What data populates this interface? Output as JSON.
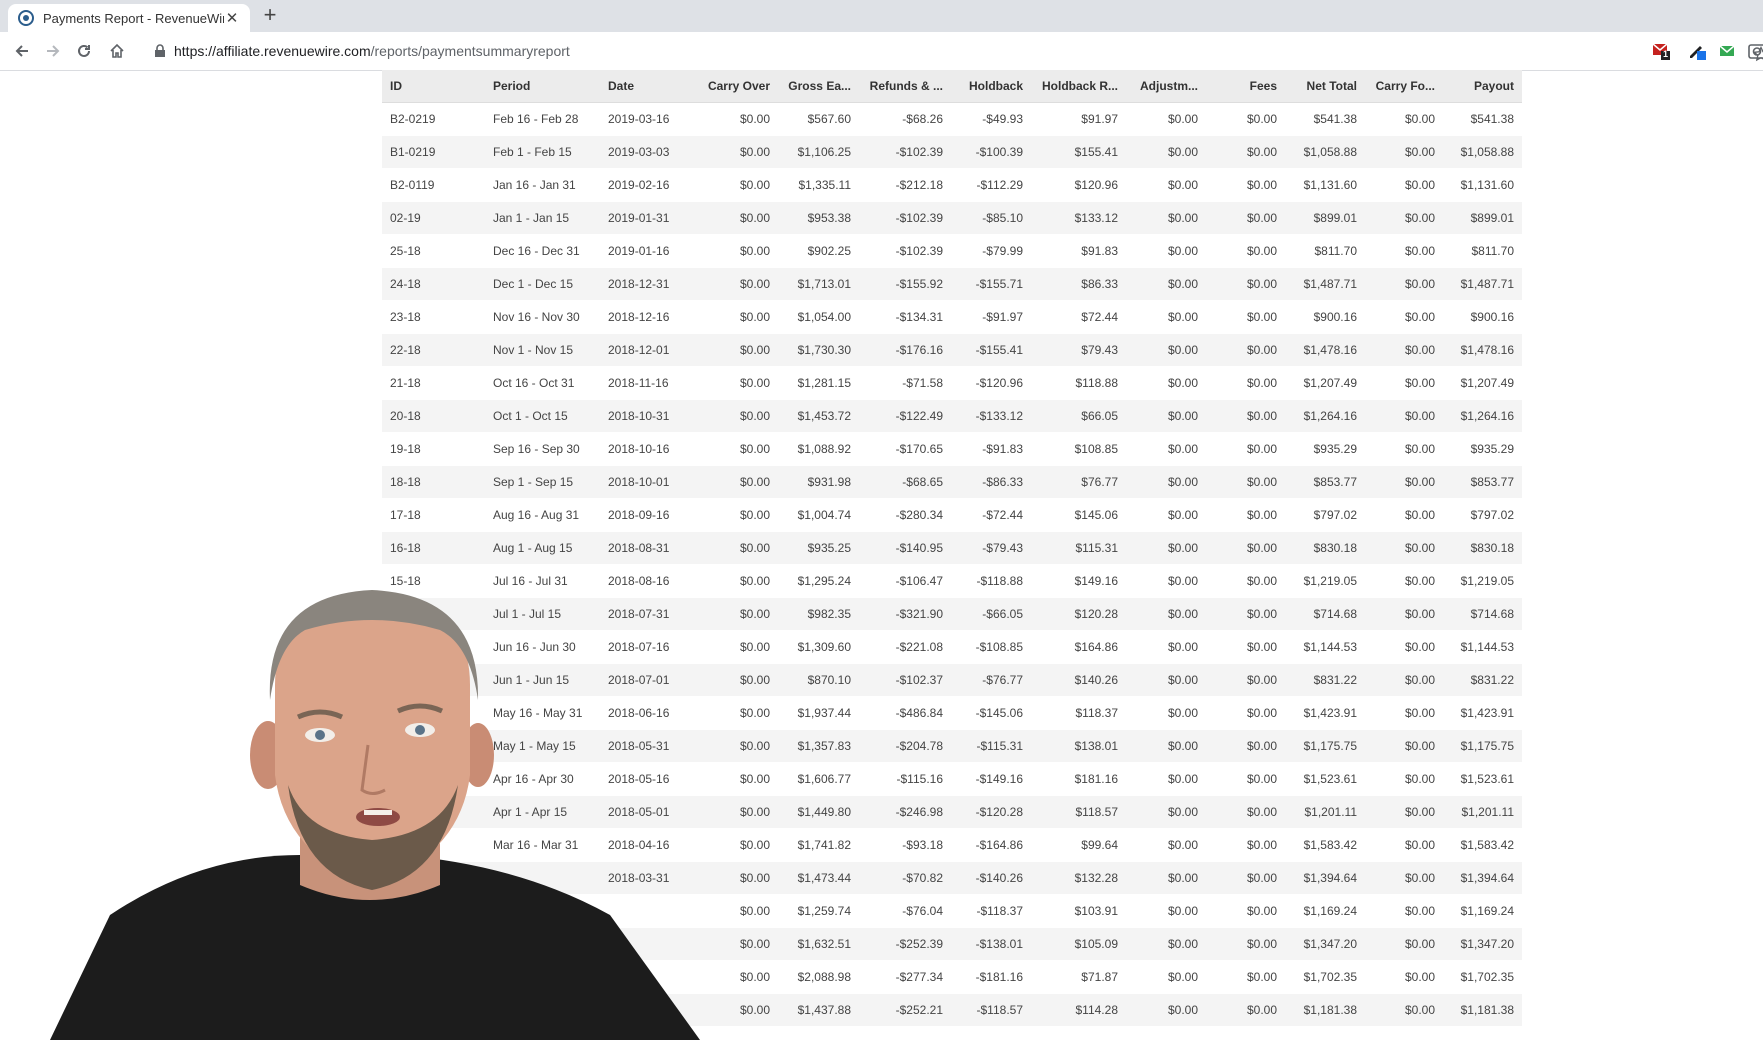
{
  "browser": {
    "tab_title": "Payments Report - RevenueWire",
    "url_host": "https://affiliate.revenuewire.com",
    "url_path": "/reports/paymentsummaryreport",
    "ext_badge": "1"
  },
  "table": {
    "columns": [
      "ID",
      "Period",
      "Date",
      "Carry Over",
      "Gross Ea...",
      "Refunds & ...",
      "Holdback",
      "Holdback R...",
      "Adjustm...",
      "Fees",
      "Net Total",
      "Carry Fo...",
      "Payout"
    ],
    "rows": [
      [
        "B2-0219",
        "Feb 16 - Feb 28",
        "2019-03-16",
        "$0.00",
        "$567.60",
        "-$68.26",
        "-$49.93",
        "$91.97",
        "$0.00",
        "$0.00",
        "$541.38",
        "$0.00",
        "$541.38"
      ],
      [
        "B1-0219",
        "Feb 1 - Feb 15",
        "2019-03-03",
        "$0.00",
        "$1,106.25",
        "-$102.39",
        "-$100.39",
        "$155.41",
        "$0.00",
        "$0.00",
        "$1,058.88",
        "$0.00",
        "$1,058.88"
      ],
      [
        "B2-0119",
        "Jan 16 - Jan 31",
        "2019-02-16",
        "$0.00",
        "$1,335.11",
        "-$212.18",
        "-$112.29",
        "$120.96",
        "$0.00",
        "$0.00",
        "$1,131.60",
        "$0.00",
        "$1,131.60"
      ],
      [
        "02-19",
        "Jan 1 - Jan 15",
        "2019-01-31",
        "$0.00",
        "$953.38",
        "-$102.39",
        "-$85.10",
        "$133.12",
        "$0.00",
        "$0.00",
        "$899.01",
        "$0.00",
        "$899.01"
      ],
      [
        "25-18",
        "Dec 16 - Dec 31",
        "2019-01-16",
        "$0.00",
        "$902.25",
        "-$102.39",
        "-$79.99",
        "$91.83",
        "$0.00",
        "$0.00",
        "$811.70",
        "$0.00",
        "$811.70"
      ],
      [
        "24-18",
        "Dec 1 - Dec 15",
        "2018-12-31",
        "$0.00",
        "$1,713.01",
        "-$155.92",
        "-$155.71",
        "$86.33",
        "$0.00",
        "$0.00",
        "$1,487.71",
        "$0.00",
        "$1,487.71"
      ],
      [
        "23-18",
        "Nov 16 - Nov 30",
        "2018-12-16",
        "$0.00",
        "$1,054.00",
        "-$134.31",
        "-$91.97",
        "$72.44",
        "$0.00",
        "$0.00",
        "$900.16",
        "$0.00",
        "$900.16"
      ],
      [
        "22-18",
        "Nov 1 - Nov 15",
        "2018-12-01",
        "$0.00",
        "$1,730.30",
        "-$176.16",
        "-$155.41",
        "$79.43",
        "$0.00",
        "$0.00",
        "$1,478.16",
        "$0.00",
        "$1,478.16"
      ],
      [
        "21-18",
        "Oct 16 - Oct 31",
        "2018-11-16",
        "$0.00",
        "$1,281.15",
        "-$71.58",
        "-$120.96",
        "$118.88",
        "$0.00",
        "$0.00",
        "$1,207.49",
        "$0.00",
        "$1,207.49"
      ],
      [
        "20-18",
        "Oct 1 - Oct 15",
        "2018-10-31",
        "$0.00",
        "$1,453.72",
        "-$122.49",
        "-$133.12",
        "$66.05",
        "$0.00",
        "$0.00",
        "$1,264.16",
        "$0.00",
        "$1,264.16"
      ],
      [
        "19-18",
        "Sep 16 - Sep 30",
        "2018-10-16",
        "$0.00",
        "$1,088.92",
        "-$170.65",
        "-$91.83",
        "$108.85",
        "$0.00",
        "$0.00",
        "$935.29",
        "$0.00",
        "$935.29"
      ],
      [
        "18-18",
        "Sep 1 - Sep 15",
        "2018-10-01",
        "$0.00",
        "$931.98",
        "-$68.65",
        "-$86.33",
        "$76.77",
        "$0.00",
        "$0.00",
        "$853.77",
        "$0.00",
        "$853.77"
      ],
      [
        "17-18",
        "Aug 16 - Aug 31",
        "2018-09-16",
        "$0.00",
        "$1,004.74",
        "-$280.34",
        "-$72.44",
        "$145.06",
        "$0.00",
        "$0.00",
        "$797.02",
        "$0.00",
        "$797.02"
      ],
      [
        "16-18",
        "Aug 1 - Aug 15",
        "2018-08-31",
        "$0.00",
        "$935.25",
        "-$140.95",
        "-$79.43",
        "$115.31",
        "$0.00",
        "$0.00",
        "$830.18",
        "$0.00",
        "$830.18"
      ],
      [
        "15-18",
        "Jul 16 - Jul 31",
        "2018-08-16",
        "$0.00",
        "$1,295.24",
        "-$106.47",
        "-$118.88",
        "$149.16",
        "$0.00",
        "$0.00",
        "$1,219.05",
        "$0.00",
        "$1,219.05"
      ],
      [
        "",
        "Jul 1 - Jul 15",
        "2018-07-31",
        "$0.00",
        "$982.35",
        "-$321.90",
        "-$66.05",
        "$120.28",
        "$0.00",
        "$0.00",
        "$714.68",
        "$0.00",
        "$714.68"
      ],
      [
        "",
        "Jun 16 - Jun 30",
        "2018-07-16",
        "$0.00",
        "$1,309.60",
        "-$221.08",
        "-$108.85",
        "$164.86",
        "$0.00",
        "$0.00",
        "$1,144.53",
        "$0.00",
        "$1,144.53"
      ],
      [
        "",
        "Jun 1 - Jun 15",
        "2018-07-01",
        "$0.00",
        "$870.10",
        "-$102.37",
        "-$76.77",
        "$140.26",
        "$0.00",
        "$0.00",
        "$831.22",
        "$0.00",
        "$831.22"
      ],
      [
        "",
        "May 16 - May 31",
        "2018-06-16",
        "$0.00",
        "$1,937.44",
        "-$486.84",
        "-$145.06",
        "$118.37",
        "$0.00",
        "$0.00",
        "$1,423.91",
        "$0.00",
        "$1,423.91"
      ],
      [
        "",
        "May 1 - May 15",
        "2018-05-31",
        "$0.00",
        "$1,357.83",
        "-$204.78",
        "-$115.31",
        "$138.01",
        "$0.00",
        "$0.00",
        "$1,175.75",
        "$0.00",
        "$1,175.75"
      ],
      [
        "",
        "Apr 16 - Apr 30",
        "2018-05-16",
        "$0.00",
        "$1,606.77",
        "-$115.16",
        "-$149.16",
        "$181.16",
        "$0.00",
        "$0.00",
        "$1,523.61",
        "$0.00",
        "$1,523.61"
      ],
      [
        "",
        "Apr 1 - Apr 15",
        "2018-05-01",
        "$0.00",
        "$1,449.80",
        "-$246.98",
        "-$120.28",
        "$118.57",
        "$0.00",
        "$0.00",
        "$1,201.11",
        "$0.00",
        "$1,201.11"
      ],
      [
        "",
        "Mar 16 - Mar 31",
        "2018-04-16",
        "$0.00",
        "$1,741.82",
        "-$93.18",
        "-$164.86",
        "$99.64",
        "$0.00",
        "$0.00",
        "$1,583.42",
        "$0.00",
        "$1,583.42"
      ],
      [
        "",
        "",
        "2018-03-31",
        "$0.00",
        "$1,473.44",
        "-$70.82",
        "-$140.26",
        "$132.28",
        "$0.00",
        "$0.00",
        "$1,394.64",
        "$0.00",
        "$1,394.64"
      ],
      [
        "",
        "",
        "",
        "$0.00",
        "$1,259.74",
        "-$76.04",
        "-$118.37",
        "$103.91",
        "$0.00",
        "$0.00",
        "$1,169.24",
        "$0.00",
        "$1,169.24"
      ],
      [
        "",
        "",
        "",
        "$0.00",
        "$1,632.51",
        "-$252.39",
        "-$138.01",
        "$105.09",
        "$0.00",
        "$0.00",
        "$1,347.20",
        "$0.00",
        "$1,347.20"
      ],
      [
        "",
        "",
        "",
        "$0.00",
        "$2,088.98",
        "-$277.34",
        "-$181.16",
        "$71.87",
        "$0.00",
        "$0.00",
        "$1,702.35",
        "$0.00",
        "$1,702.35"
      ],
      [
        "",
        "",
        "",
        "$0.00",
        "$1,437.88",
        "-$252.21",
        "-$118.57",
        "$114.28",
        "$0.00",
        "$0.00",
        "$1,181.38",
        "$0.00",
        "$1,181.38"
      ]
    ]
  }
}
